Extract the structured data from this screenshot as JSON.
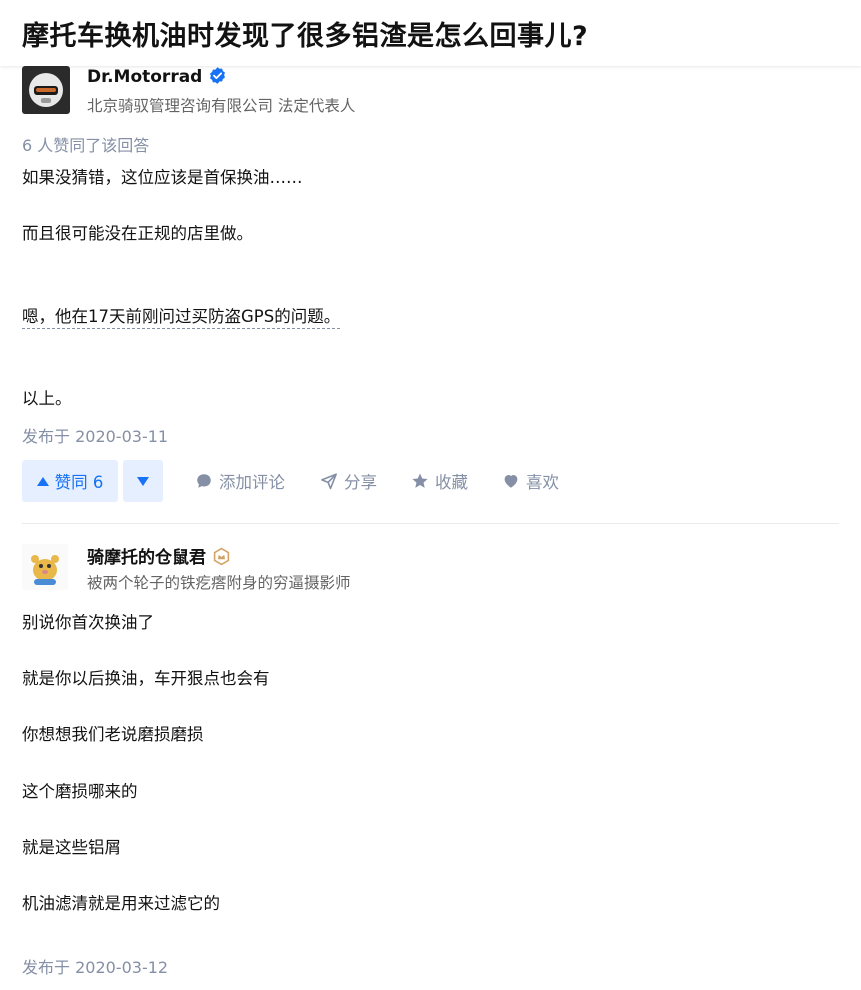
{
  "question": {
    "title": "摩托车换机油时发现了很多铝渣是怎么回事儿?"
  },
  "answers": [
    {
      "author": {
        "name": "Dr.Motorrad",
        "headline": "北京骑驭管理咨询有限公司 法定代表人",
        "badge_icon": "verified-badge-icon",
        "badge_color": "#1772f6"
      },
      "voters_text": "6 人赞同了该回答",
      "paragraphs": [
        "如果没猜错，这位应该是首保换油……",
        "而且很可能没在正规的店里做。",
        "嗯，他在17天前刚问过买防盗GPS的问题。",
        "以上。"
      ],
      "date": "发布于 2020-03-11",
      "actions": {
        "vote_up": "赞同 6",
        "comment": "添加评论",
        "share": "分享",
        "collect": "收藏",
        "like": "喜欢"
      }
    },
    {
      "author": {
        "name": "骑摩托的仓鼠君",
        "headline": "被两个轮子的铁疙瘩附身的穷逼摄影师",
        "badge_icon": "achievement-badge-icon",
        "badge_color": "#d4a266"
      },
      "paragraphs": [
        "别说你首次换油了",
        "就是你以后换油，车开狠点也会有",
        "你想想我们老说磨损磨损",
        "这个磨损哪来的",
        "就是这些铝屑",
        "机油滤清就是用来过滤它的"
      ],
      "date": "发布于 2020-03-12"
    }
  ],
  "colors": {
    "accent": "#1772f6",
    "accent_bg": "#e5efff",
    "muted": "#8590a6",
    "text": "#121212"
  }
}
